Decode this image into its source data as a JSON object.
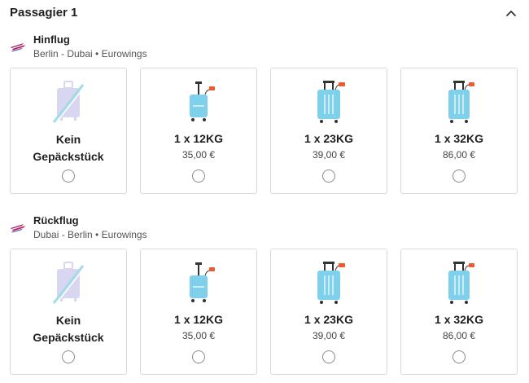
{
  "passenger": {
    "title": "Passagier 1"
  },
  "flights": [
    {
      "title": "Hinflug",
      "route": "Berlin - Dubai • Eurowings",
      "options": [
        {
          "type": "none",
          "line1": "Kein",
          "line2": "Gepäckstück"
        },
        {
          "type": "bag",
          "weight": "1 x 12KG",
          "price": "35,00 €"
        },
        {
          "type": "bag",
          "weight": "1 x 23KG",
          "price": "39,00 €"
        },
        {
          "type": "bag",
          "weight": "1 x 32KG",
          "price": "86,00 €"
        }
      ]
    },
    {
      "title": "Rückflug",
      "route": "Dubai - Berlin • Eurowings",
      "options": [
        {
          "type": "none",
          "line1": "Kein",
          "line2": "Gepäckstück"
        },
        {
          "type": "bag",
          "weight": "1 x 12KG",
          "price": "35,00 €"
        },
        {
          "type": "bag",
          "weight": "1 x 23KG",
          "price": "39,00 €"
        },
        {
          "type": "bag",
          "weight": "1 x 32KG",
          "price": "86,00 €"
        }
      ]
    }
  ],
  "colors": {
    "suitcase": "#7fd0ea",
    "tag": "#f0582f",
    "none_bag": "#d8d6f0",
    "slash": "#9fdcea",
    "logo_top": "#9b1c57",
    "logo_bottom": "#5b6cc4"
  }
}
